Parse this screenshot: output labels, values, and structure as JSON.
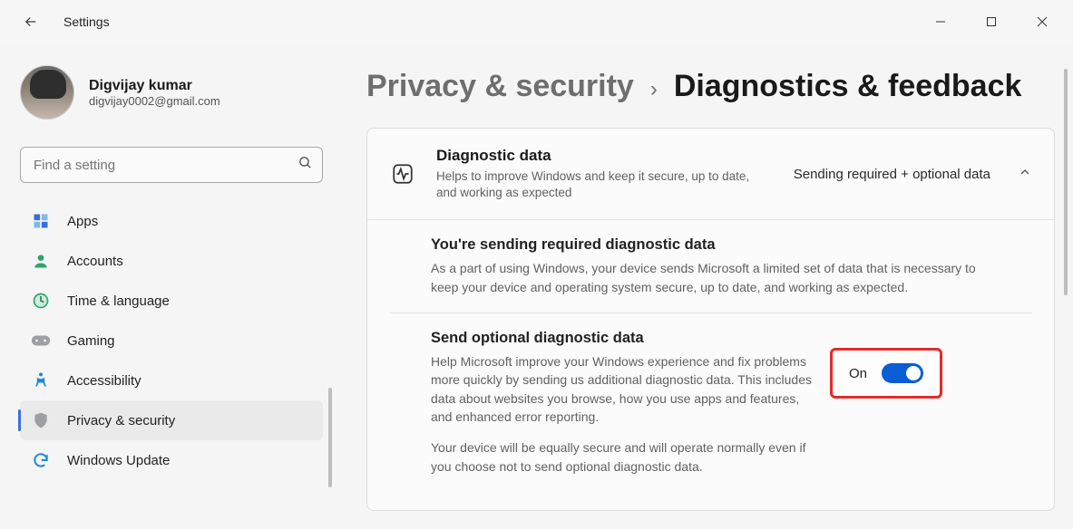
{
  "app": {
    "title": "Settings"
  },
  "user": {
    "name": "Digvijay kumar",
    "email": "digvijay0002@gmail.com"
  },
  "search": {
    "placeholder": "Find a setting"
  },
  "sidebar": {
    "items": [
      {
        "label": "Apps"
      },
      {
        "label": "Accounts"
      },
      {
        "label": "Time & language"
      },
      {
        "label": "Gaming"
      },
      {
        "label": "Accessibility"
      },
      {
        "label": "Privacy & security"
      },
      {
        "label": "Windows Update"
      }
    ]
  },
  "breadcrumb": {
    "parent": "Privacy & security",
    "current": "Diagnostics & feedback"
  },
  "diagnostic": {
    "header_title": "Diagnostic data",
    "header_sub": "Helps to improve Windows and keep it secure, up to date, and working as expected",
    "header_status": "Sending required + optional data",
    "required_title": "You're sending required diagnostic data",
    "required_body": "As a part of using Windows, your device sends Microsoft a limited set of data that is necessary to keep your device and operating system secure, up to date, and working as expected.",
    "optional_title": "Send optional diagnostic data",
    "optional_body1": "Help Microsoft improve your Windows experience and fix problems more quickly by sending us additional diagnostic data. This includes data about websites you browse, how you use apps and features, and enhanced error reporting.",
    "optional_body2": "Your device will be equally secure and will operate normally even if you choose not to send optional diagnostic data.",
    "toggle_label": "On"
  }
}
